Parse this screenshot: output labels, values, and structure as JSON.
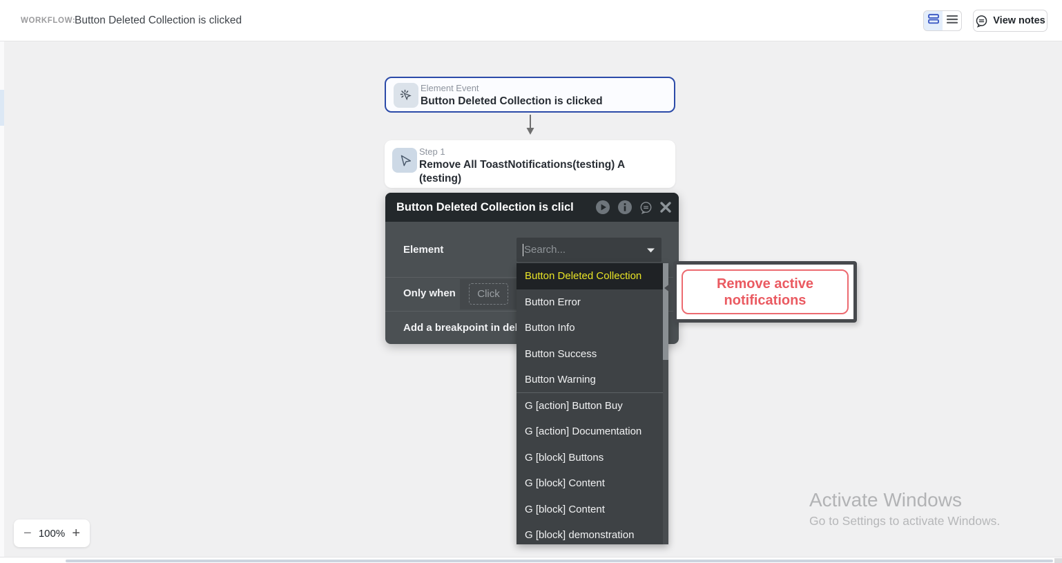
{
  "colors": {
    "accent_blue": "#2b4aa8",
    "highlight_yellow": "#e9e426",
    "tooltip_red": "#ea5a61"
  },
  "topbar": {
    "workflow_label": "WORKFLOW:",
    "workflow_title": "Button Deleted Collection is clicked",
    "view_notes_label": "View notes"
  },
  "canvas": {
    "event_node": {
      "type_label": "Element Event",
      "title": "Button Deleted Collection is clicked"
    },
    "step_node": {
      "step_label": "Step 1",
      "title": "Remove All ToastNotifications(testing) A (testing)"
    }
  },
  "popup": {
    "title": "Button Deleted Collection is clicl",
    "element_label": "Element",
    "search_placeholder": "Search...",
    "only_when_label": "Only when",
    "click_button_label": "Click",
    "breakpoint_label": "Add a breakpoint in deb"
  },
  "dropdown": {
    "items": [
      {
        "label": "Button Deleted Collection",
        "selected": true
      },
      {
        "label": "Button Error"
      },
      {
        "label": "Button Info"
      },
      {
        "label": "Button Success"
      },
      {
        "label": "Button Warning",
        "divider_after": true
      },
      {
        "label": "G [action] Button Buy"
      },
      {
        "label": "G [action] Documentation"
      },
      {
        "label": "G [block] Buttons"
      },
      {
        "label": "G [block] Content"
      },
      {
        "label": "G [block] Content"
      },
      {
        "label": "G [block] demonstration"
      }
    ]
  },
  "tooltip": {
    "text": "Remove active notifications"
  },
  "zoom_control": {
    "minus_label": "−",
    "level": "100%",
    "plus_label": "+"
  },
  "watermark": {
    "title": "Activate Windows",
    "subtitle": "Go to Settings to activate Windows."
  }
}
